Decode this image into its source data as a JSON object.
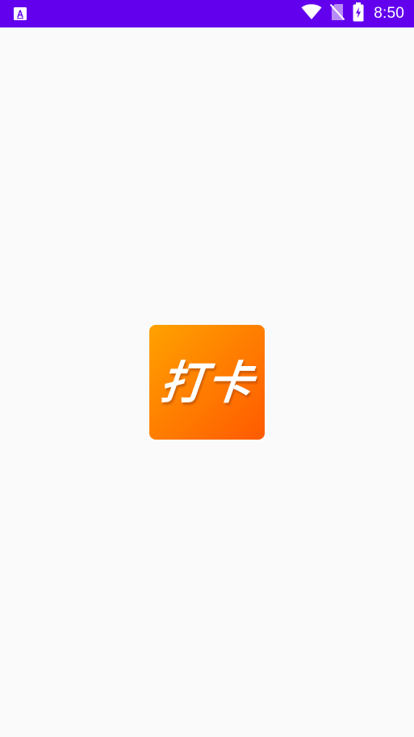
{
  "status_bar": {
    "time": "8:50",
    "background_color": "#6200ee",
    "left_icon": "app-notification-icon",
    "icons": [
      "wifi-icon",
      "no-sim-icon",
      "battery-charging-icon"
    ]
  },
  "splash": {
    "background_color": "#fafafa",
    "logo": {
      "text": "打卡",
      "gradient_start": "#ffa200",
      "gradient_end": "#ff5a00",
      "text_color": "#ffffff"
    }
  }
}
